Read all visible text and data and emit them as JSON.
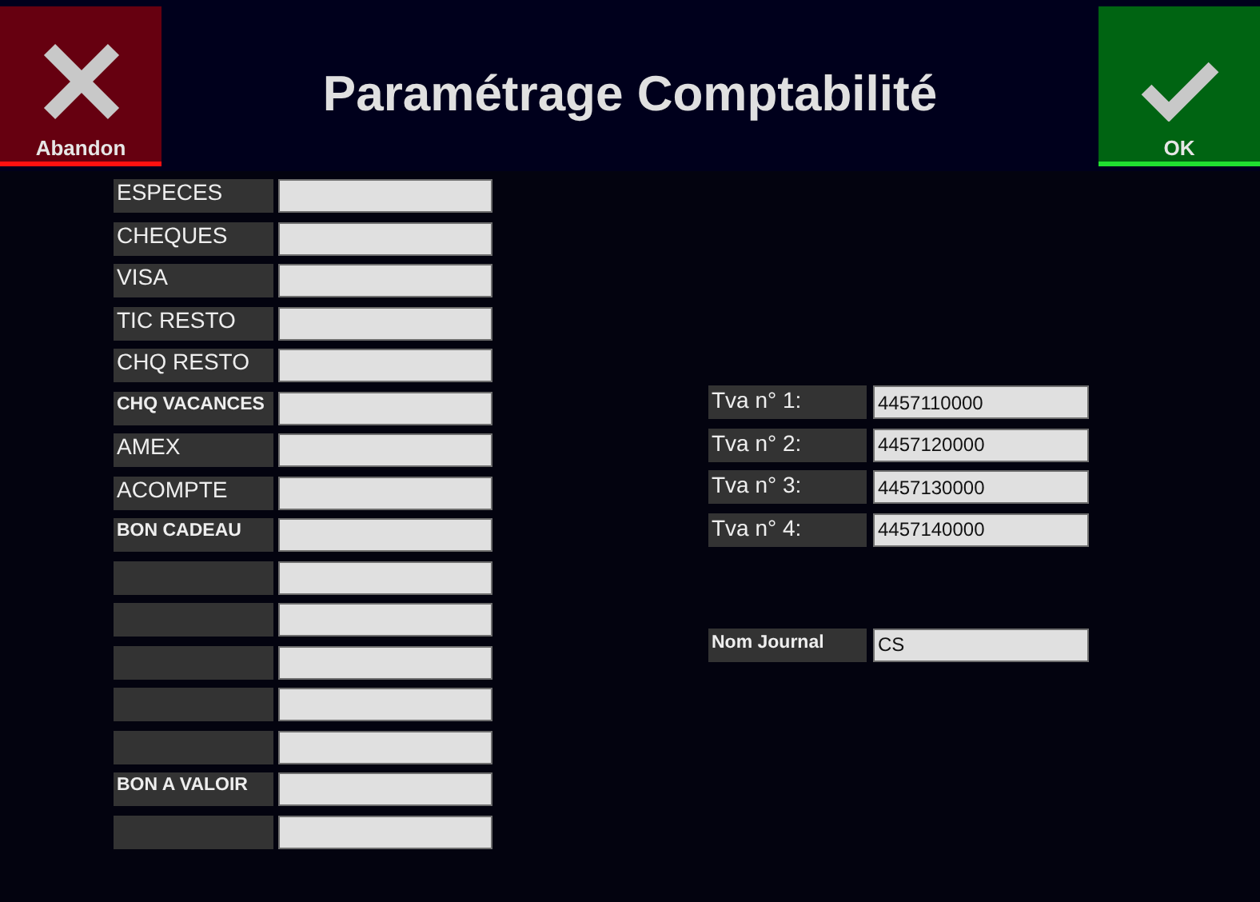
{
  "header": {
    "title": "Paramétrage Comptabilité",
    "cancel_button": {
      "label": "Abandon"
    },
    "ok_button": {
      "label": "OK"
    }
  },
  "payment_accounts": [
    {
      "label": "ESPECES"
    },
    {
      "label": "CHEQUES"
    },
    {
      "label": "VISA"
    },
    {
      "label": "TIC RESTO"
    },
    {
      "label": "CHQ RESTO"
    },
    {
      "label": "CHQ VACANCES",
      "kind": "small"
    },
    {
      "label": "AMEX"
    },
    {
      "label": "ACOMPTE"
    },
    {
      "label": "BON CADEAU",
      "kind": "small"
    },
    {
      "kind": "blank"
    },
    {
      "kind": "blank"
    },
    {
      "kind": "blank"
    },
    {
      "kind": "blank"
    },
    {
      "kind": "blank"
    },
    {
      "label": "BON A VALOIR",
      "kind": "small"
    },
    {
      "kind": "blank"
    }
  ],
  "vat_accounts": [
    {
      "label": "Tva n° 1:",
      "value": "4457110000"
    },
    {
      "label": "Tva n° 2:",
      "value": "4457120000"
    },
    {
      "label": "Tva n° 3:",
      "value": "4457130000"
    },
    {
      "label": "Tva n° 4:",
      "value": "4457140000"
    }
  ],
  "journal": {
    "label": "Nom Journal",
    "value": "CS"
  }
}
